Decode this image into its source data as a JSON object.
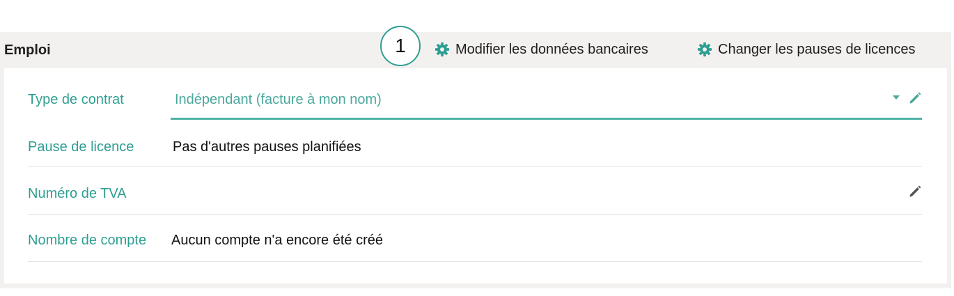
{
  "section": {
    "title": "Emploi",
    "step_badge": "1",
    "actions": {
      "bank_label": "Modifier les données bancaires",
      "pauses_label": "Changer les pauses de licences",
      "icon": "gear-icon"
    }
  },
  "fields": {
    "contract": {
      "label": "Type de contrat",
      "value": "Indépendant (facture à mon nom)"
    },
    "pause": {
      "label": "Pause de licence",
      "value": "Pas d'autres pauses planifiées"
    },
    "vat": {
      "label": "Numéro de TVA",
      "value": ""
    },
    "accounts": {
      "label": "Nombre de compte",
      "value": "Aucun compte n'a encore été créé"
    }
  },
  "colors": {
    "accent": "#2f9e92",
    "panel_background": "#f3f1ef",
    "text": "#1f1f1f"
  }
}
